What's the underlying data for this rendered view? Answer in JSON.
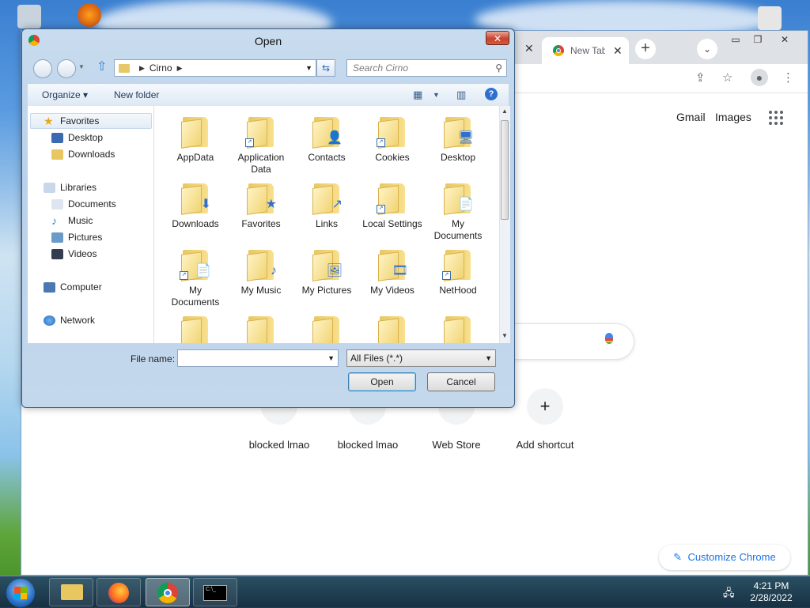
{
  "colors": {
    "dialog_frame": "#b9d1ea",
    "accent_blue": "#1a73e8",
    "chrome_tabbar": "#dee1e6"
  },
  "dialog": {
    "title": "Open",
    "address": {
      "location": "Cirno"
    },
    "search_placeholder": "Search Cirno",
    "toolbar": {
      "organize": "Organize",
      "new_folder": "New folder"
    },
    "nav": {
      "favorites": "Favorites",
      "desktop": "Desktop",
      "downloads": "Downloads",
      "libraries": "Libraries",
      "documents": "Documents",
      "music": "Music",
      "pictures": "Pictures",
      "videos": "Videos",
      "computer": "Computer",
      "network": "Network"
    },
    "items": [
      {
        "name": "AppData",
        "icon": "folder-icon"
      },
      {
        "name": "Application Data",
        "icon": "shortcut-folder-icon"
      },
      {
        "name": "Contacts",
        "icon": "contacts-folder-icon"
      },
      {
        "name": "Cookies",
        "icon": "shortcut-folder-icon"
      },
      {
        "name": "Desktop",
        "icon": "desktop-folder-icon"
      },
      {
        "name": "Downloads",
        "icon": "downloads-folder-icon"
      },
      {
        "name": "Favorites",
        "icon": "favorites-folder-icon"
      },
      {
        "name": "Links",
        "icon": "links-folder-icon"
      },
      {
        "name": "Local Settings",
        "icon": "shortcut-folder-icon"
      },
      {
        "name": "My Documents",
        "icon": "documents-folder-icon"
      },
      {
        "name": "My Documents",
        "icon": "shortcut-documents-folder-icon"
      },
      {
        "name": "My Music",
        "icon": "music-folder-icon"
      },
      {
        "name": "My Pictures",
        "icon": "pictures-folder-icon"
      },
      {
        "name": "My Videos",
        "icon": "videos-folder-icon"
      },
      {
        "name": "NetHood",
        "icon": "shortcut-folder-icon"
      }
    ],
    "file_name_label": "File name:",
    "file_name_value": "",
    "file_type": "All Files (*.*)",
    "open_button": "Open",
    "cancel_button": "Cancel"
  },
  "chrome": {
    "tab_title": "New Tab",
    "header_links": {
      "gmail": "Gmail",
      "images": "Images"
    },
    "shortcuts": [
      {
        "label": "blocked lmao"
      },
      {
        "label": "blocked lmao"
      },
      {
        "label": "Web Store"
      },
      {
        "label": "Add shortcut"
      }
    ],
    "customize": "Customize Chrome"
  },
  "taskbar": {
    "time": "4:21 PM",
    "date": "2/28/2022"
  }
}
